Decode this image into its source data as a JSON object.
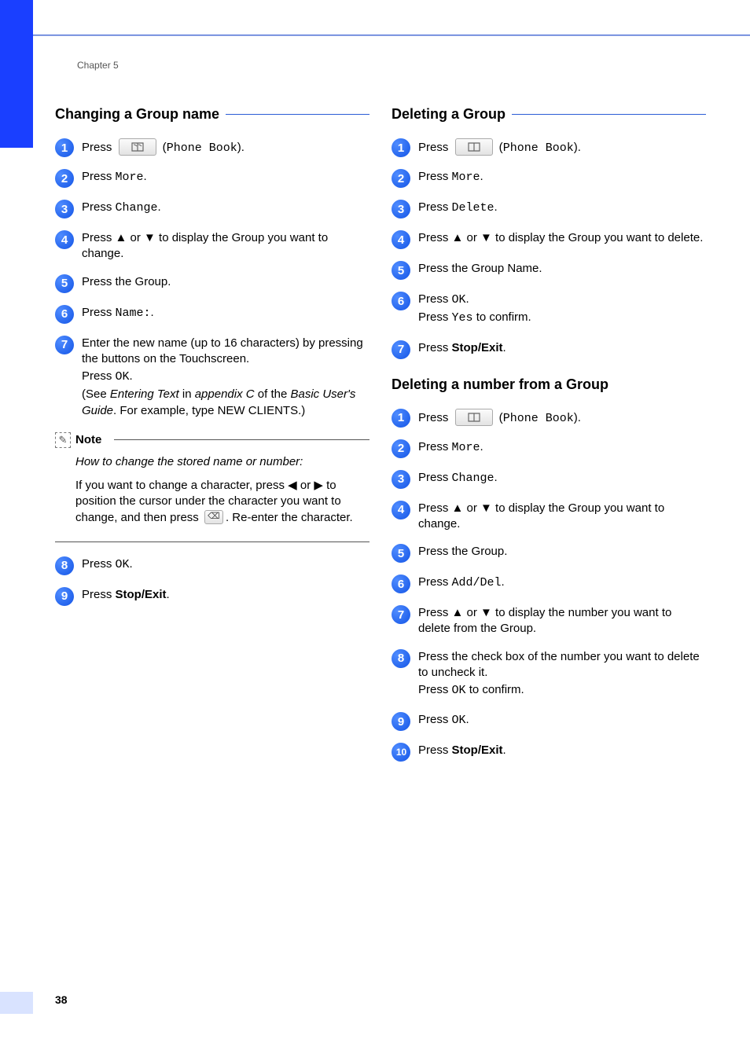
{
  "chapter": "Chapter 5",
  "pageNumber": "38",
  "left": {
    "h1": "Changing a Group name",
    "steps": {
      "s1a": "Press ",
      "s1b": " (",
      "s1c": "Phone Book",
      "s1d": ").",
      "s2a": "Press ",
      "s2b": "More",
      "s2c": ".",
      "s3a": "Press ",
      "s3b": "Change",
      "s3c": ".",
      "s4": "Press ▲ or ▼ to display the Group you want to change.",
      "s5": "Press the Group.",
      "s6a": "Press ",
      "s6b": "Name:",
      "s6c": ".",
      "s7a": "Enter the new name (up to 16 characters) by pressing the buttons on the Touchscreen.",
      "s7b": "Press ",
      "s7c": "OK",
      "s7d": ".",
      "s7e": "(See ",
      "s7f": "Entering Text",
      "s7g": " in ",
      "s7h": "appendix C",
      "s7i": " of the ",
      "s7j": "Basic User's Guide",
      "s7k": ". For example, type NEW CLIENTS.)",
      "s8a": "Press ",
      "s8b": "OK",
      "s8c": ".",
      "s9a": "Press ",
      "s9b": "Stop/Exit",
      "s9c": "."
    },
    "note": {
      "label": "Note",
      "p1": "How to change the stored name or number:",
      "p2a": "If you want to change a character, press ◀ or ▶ to position the cursor under the character you want to change, and then press ",
      "p2b": ". Re-enter the character."
    }
  },
  "right1": {
    "h1": "Deleting a Group",
    "steps": {
      "s1a": "Press ",
      "s1b": " (",
      "s1c": "Phone Book",
      "s1d": ").",
      "s2a": "Press ",
      "s2b": "More",
      "s2c": ".",
      "s3a": "Press ",
      "s3b": "Delete",
      "s3c": ".",
      "s4": "Press ▲ or ▼ to display the Group you want to delete.",
      "s5": "Press the Group Name.",
      "s6a": "Press ",
      "s6b": "OK",
      "s6c": ".",
      "s6d": "Press ",
      "s6e": "Yes",
      "s6f": " to confirm.",
      "s7a": "Press ",
      "s7b": "Stop/Exit",
      "s7c": "."
    }
  },
  "right2": {
    "h1": "Deleting a number from a Group",
    "steps": {
      "s1a": "Press ",
      "s1b": " (",
      "s1c": "Phone Book",
      "s1d": ").",
      "s2a": "Press ",
      "s2b": "More",
      "s2c": ".",
      "s3a": "Press ",
      "s3b": "Change",
      "s3c": ".",
      "s4": "Press ▲ or ▼ to display the Group you want to change.",
      "s5": "Press the Group.",
      "s6a": "Press ",
      "s6b": "Add/Del",
      "s6c": ".",
      "s7": "Press ▲ or ▼ to display the number you want to delete from the Group.",
      "s8a": "Press the check box of the number you want to delete to uncheck it.",
      "s8b": "Press ",
      "s8c": "OK",
      "s8d": " to confirm.",
      "s9a": "Press ",
      "s9b": "OK",
      "s9c": ".",
      "s10a": "Press ",
      "s10b": "Stop/Exit",
      "s10c": "."
    }
  }
}
